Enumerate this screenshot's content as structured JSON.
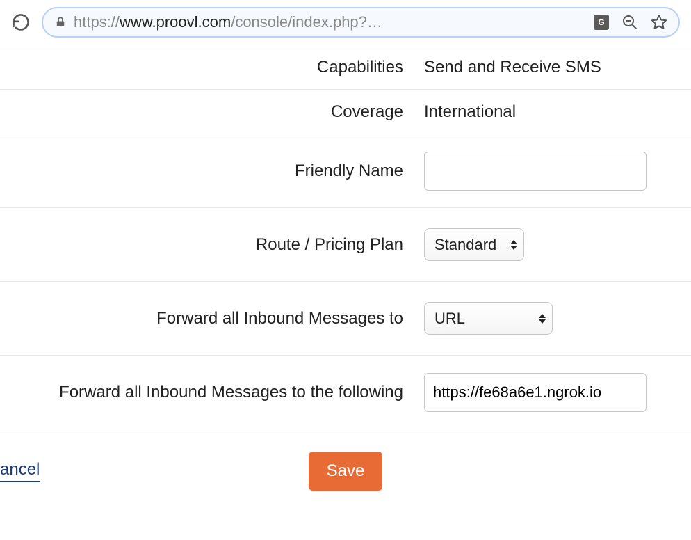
{
  "browser": {
    "url_proto": "https://",
    "url_host": "www.proovl.com",
    "url_path": "/console/index.php?…",
    "icons": {
      "reload": "reload-icon",
      "lock": "lock-icon",
      "translate": "translate-icon",
      "translate_text": "G",
      "zoom_out": "zoom-out-icon",
      "star": "star-icon"
    }
  },
  "form": {
    "capabilities": {
      "label": "Capabilities",
      "value": "Send and Receive SMS"
    },
    "coverage": {
      "label": "Coverage",
      "value": "International"
    },
    "friendly_name": {
      "label": "Friendly Name",
      "value": ""
    },
    "route": {
      "label": "Route / Pricing Plan",
      "selected": "Standard"
    },
    "forward_to": {
      "label": "Forward all Inbound Messages to",
      "selected": "URL"
    },
    "forward_url": {
      "label": "Forward all Inbound Messages to the following",
      "value": "https://fe68a6e1.ngrok.io"
    }
  },
  "actions": {
    "cancel": "ancel",
    "save": "Save"
  }
}
